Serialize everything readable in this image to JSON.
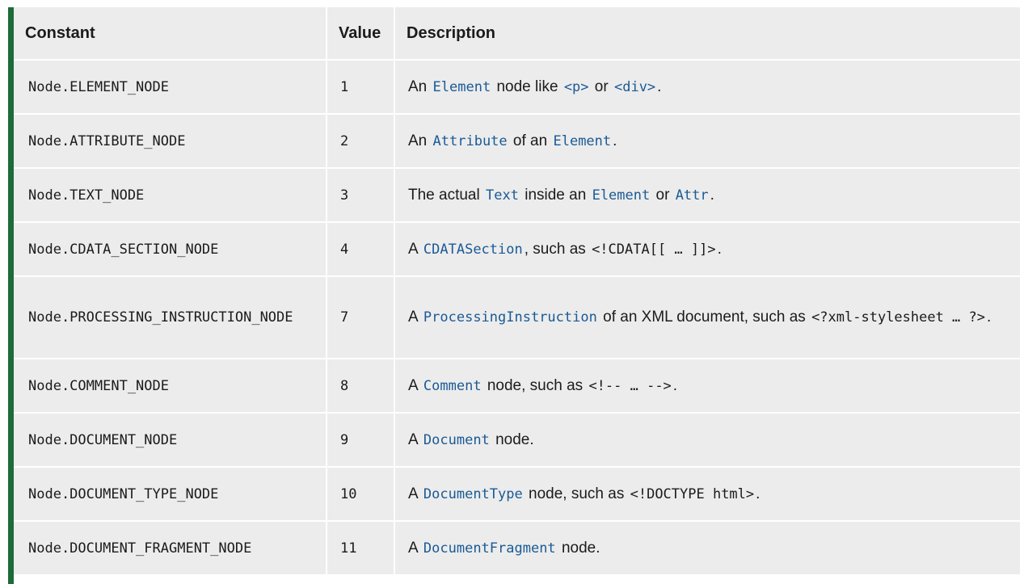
{
  "headers": {
    "constant": "Constant",
    "value": "Value",
    "description": "Description"
  },
  "rows": [
    {
      "constant": "Node.ELEMENT_NODE",
      "value": "1",
      "desc": [
        {
          "t": "An "
        },
        {
          "t": "Element",
          "c": "link"
        },
        {
          "t": " node like "
        },
        {
          "t": "<p>",
          "c": "link"
        },
        {
          "t": " or "
        },
        {
          "t": "<div>",
          "c": "link"
        },
        {
          "t": "."
        }
      ]
    },
    {
      "constant": "Node.ATTRIBUTE_NODE",
      "value": "2",
      "desc": [
        {
          "t": "An "
        },
        {
          "t": "Attribute",
          "c": "link"
        },
        {
          "t": " of an "
        },
        {
          "t": "Element",
          "c": "link"
        },
        {
          "t": "."
        }
      ]
    },
    {
      "constant": "Node.TEXT_NODE",
      "value": "3",
      "desc": [
        {
          "t": "The actual "
        },
        {
          "t": "Text",
          "c": "link"
        },
        {
          "t": " inside an "
        },
        {
          "t": "Element",
          "c": "link"
        },
        {
          "t": " or "
        },
        {
          "t": "Attr",
          "c": "link"
        },
        {
          "t": "."
        }
      ]
    },
    {
      "constant": "Node.CDATA_SECTION_NODE",
      "value": "4",
      "desc": [
        {
          "t": "A "
        },
        {
          "t": "CDATASection",
          "c": "link"
        },
        {
          "t": ", such as "
        },
        {
          "t": "<!CDATA[[ … ]]>",
          "c": "plain"
        },
        {
          "t": "."
        }
      ]
    },
    {
      "constant": "Node.PROCESSING_INSTRUCTION_NODE",
      "value": "7",
      "tall": true,
      "desc": [
        {
          "t": "A "
        },
        {
          "t": "ProcessingInstruction",
          "c": "link"
        },
        {
          "t": " of an XML document, such as "
        },
        {
          "t": "<?xml-stylesheet … ?>",
          "c": "plain"
        },
        {
          "t": "."
        }
      ]
    },
    {
      "constant": "Node.COMMENT_NODE",
      "value": "8",
      "desc": [
        {
          "t": "A "
        },
        {
          "t": "Comment",
          "c": "link"
        },
        {
          "t": " node, such as "
        },
        {
          "t": "<!-- … -->",
          "c": "plain"
        },
        {
          "t": "."
        }
      ]
    },
    {
      "constant": "Node.DOCUMENT_NODE",
      "value": "9",
      "desc": [
        {
          "t": "A "
        },
        {
          "t": "Document",
          "c": "link"
        },
        {
          "t": " node."
        }
      ]
    },
    {
      "constant": "Node.DOCUMENT_TYPE_NODE",
      "value": "10",
      "desc": [
        {
          "t": "A "
        },
        {
          "t": "DocumentType",
          "c": "link"
        },
        {
          "t": " node, such as "
        },
        {
          "t": "<!DOCTYPE html>",
          "c": "plain"
        },
        {
          "t": "."
        }
      ]
    },
    {
      "constant": "Node.DOCUMENT_FRAGMENT_NODE",
      "value": "11",
      "desc": [
        {
          "t": "A "
        },
        {
          "t": "DocumentFragment",
          "c": "link"
        },
        {
          "t": " node."
        }
      ]
    }
  ],
  "colors": {
    "accent_border": "#1e6b3a",
    "cell_bg": "#ececec",
    "link": "#1a5a96"
  }
}
